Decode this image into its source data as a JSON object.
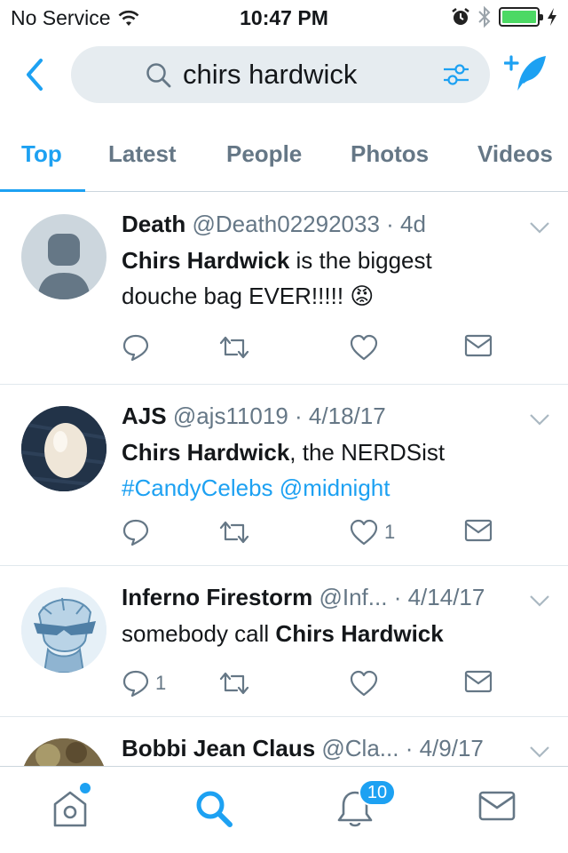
{
  "status_bar": {
    "carrier": "No Service",
    "time": "10:47 PM"
  },
  "search": {
    "query": "chirs hardwick"
  },
  "tabs": [
    {
      "label": "Top",
      "active": true
    },
    {
      "label": "Latest",
      "active": false
    },
    {
      "label": "People",
      "active": false
    },
    {
      "label": "Photos",
      "active": false
    },
    {
      "label": "Videos",
      "active": false
    }
  ],
  "tweets": [
    {
      "name": "Death",
      "handle": "@Death02292033",
      "time": "· 4d",
      "text_bold": "Chirs Hardwick",
      "text_rest": " is the biggest douche bag EVER!!!!! ",
      "emoji": "😡",
      "reply_count": "",
      "like_count": ""
    },
    {
      "name": "AJS",
      "handle": "@ajs11019",
      "time": "· 4/18/17",
      "text_bold": "Chirs Hardwick",
      "text_rest": ", the NERDSist",
      "hashtag": "#CandyCelebs",
      "mention": "@midnight",
      "reply_count": "",
      "like_count": "1"
    },
    {
      "name": "Inferno Firestorm",
      "handle": "@Inf...",
      "time": "· 4/14/17",
      "text_prefix": "somebody call ",
      "text_bold": "Chirs Hardwick",
      "reply_count": "1",
      "like_count": ""
    },
    {
      "name": "Bobbi Jean Claus",
      "handle": "@Cla...",
      "time": "· 4/9/17"
    }
  ],
  "tab_bar": {
    "notification_count": "10"
  },
  "colors": {
    "accent": "#1da1f2",
    "muted": "#657786",
    "text": "#14171a",
    "battery": "#4cd964"
  }
}
